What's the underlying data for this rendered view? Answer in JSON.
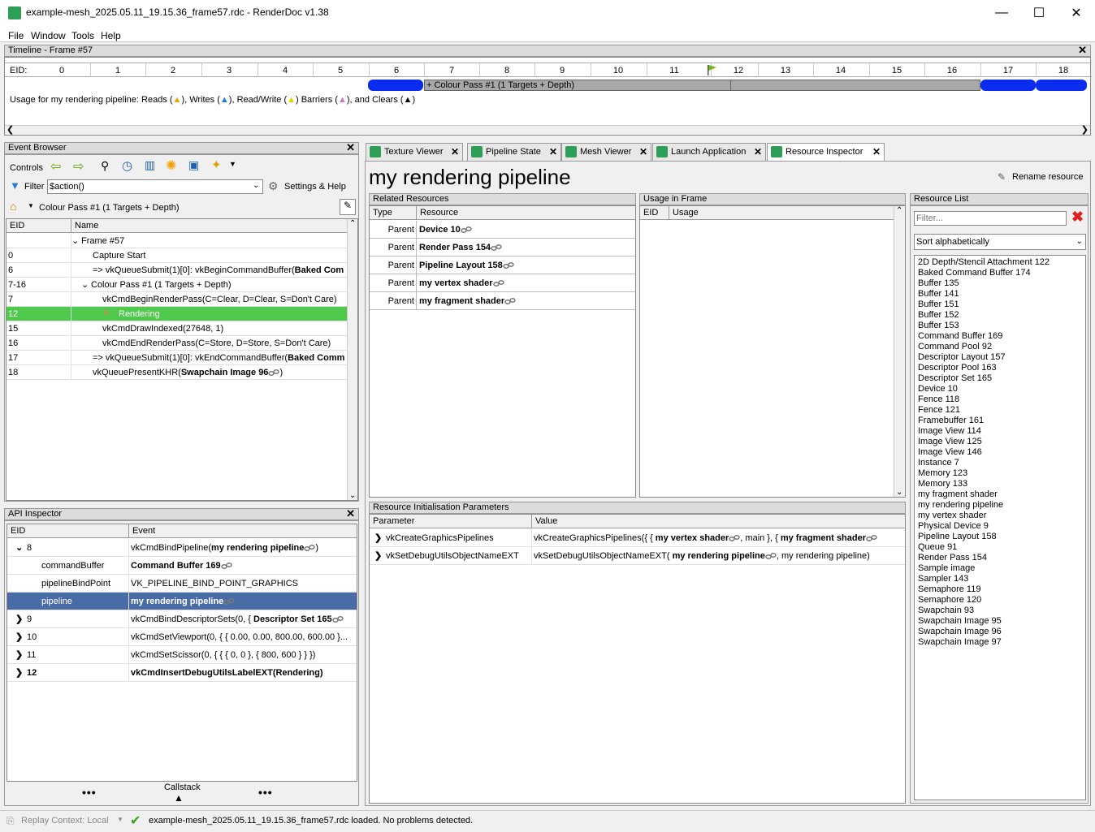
{
  "window": {
    "title": "example-mesh_2025.05.11_19.15.36_frame57.rdc - RenderDoc v1.38",
    "minimize": "—",
    "maximize": "☐",
    "close": "✕"
  },
  "menu": {
    "file": "File",
    "window": "Window",
    "tools": "Tools",
    "help": "Help"
  },
  "timeline": {
    "title": "Timeline - Frame #57",
    "eid_label": "EID:",
    "ticks": [
      "0",
      "1",
      "2",
      "3",
      "4",
      "5",
      "6",
      "7",
      "8",
      "9",
      "10",
      "11",
      "12",
      "13",
      "14",
      "15",
      "16",
      "17",
      "18"
    ],
    "pass_label": "+ Colour Pass #1 (1 Targets + Depth)",
    "usage_prefix": "Usage for my rendering pipeline: Reads (",
    "usage_writes": "), Writes (",
    "usage_rw": "), Read/Write (",
    "usage_barriers": ") Barriers (",
    "usage_clears": "), and Clears (",
    "usage_end": ")"
  },
  "event_browser": {
    "title": "Event Browser",
    "controls_label": "Controls",
    "filter_label": "Filter",
    "filter_value": "$action()",
    "settings_label": "Settings & Help",
    "breadcrumb": "Colour Pass #1 (1 Targets + Depth)",
    "col_eid": "EID",
    "col_name": "Name",
    "rows": [
      {
        "eid": "",
        "name": "Frame #57"
      },
      {
        "eid": "0",
        "name": "Capture Start"
      },
      {
        "eid": "6",
        "name": "=> vkQueueSubmit(1)[0]: vkBeginCommandBuffer(",
        "bold": "Baked Com"
      },
      {
        "eid": "7-16",
        "name": "Colour Pass #1 (1 Targets + Depth)"
      },
      {
        "eid": "7",
        "name": "vkCmdBeginRenderPass(C=Clear, D=Clear, S=Don't Care)"
      },
      {
        "eid": "12",
        "name": "Rendering"
      },
      {
        "eid": "15",
        "name": "vkCmdDrawIndexed(27648, 1)"
      },
      {
        "eid": "16",
        "name": "vkCmdEndRenderPass(C=Store, D=Store, S=Don't Care)"
      },
      {
        "eid": "17",
        "name": "=> vkQueueSubmit(1)[0]: vkEndCommandBuffer(",
        "bold": "Baked Comm"
      },
      {
        "eid": "18",
        "name": "vkQueuePresentKHR(",
        "bold": "Swapchain Image 96",
        "tail": ")"
      }
    ]
  },
  "api_inspector": {
    "title": "API Inspector",
    "col_eid": "EID",
    "col_event": "Event",
    "rows": [
      {
        "eid": "8",
        "event": "vkCmdBindPipeline(",
        "bold": "my rendering pipeline",
        "tail": ")"
      },
      {
        "eid": "commandBuffer",
        "event": "",
        "bold": "Command Buffer 169"
      },
      {
        "eid": "pipelineBindPoint",
        "event": "VK_PIPELINE_BIND_POINT_GRAPHICS"
      },
      {
        "eid": "pipeline",
        "event": "",
        "bold": "my rendering pipeline"
      },
      {
        "eid": "9",
        "event": "vkCmdBindDescriptorSets(0, { ",
        "bold": "Descriptor Set 165"
      },
      {
        "eid": "10",
        "event": "vkCmdSetViewport(0, { { 0.00, 0.00, 800.00, 600.00 }..."
      },
      {
        "eid": "11",
        "event": "vkCmdSetScissor(0, { { { 0, 0 }, { 800, 600 } } })"
      },
      {
        "eid": "12",
        "event": "",
        "bold": "vkCmdInsertDebugUtilsLabelEXT(Rendering)"
      }
    ],
    "callstack": "Callstack"
  },
  "tabs": [
    {
      "label": "Texture Viewer"
    },
    {
      "label": "Pipeline State"
    },
    {
      "label": "Mesh Viewer"
    },
    {
      "label": "Launch Application"
    },
    {
      "label": "Resource Inspector"
    }
  ],
  "resource_inspector": {
    "heading": "my rendering pipeline",
    "rename": "Rename resource",
    "related_title": "Related Resources",
    "col_type": "Type",
    "col_resource": "Resource",
    "related": [
      {
        "type": "Parent",
        "name": "Device 10"
      },
      {
        "type": "Parent",
        "name": "Render Pass 154"
      },
      {
        "type": "Parent",
        "name": "Pipeline Layout 158"
      },
      {
        "type": "Parent",
        "name": "my vertex shader"
      },
      {
        "type": "Parent",
        "name": "my fragment shader"
      }
    ],
    "usage_title": "Usage in Frame",
    "col_ueid": "EID",
    "col_usage": "Usage",
    "init_title": "Resource Initialisation Parameters",
    "col_param": "Parameter",
    "col_value": "Value",
    "init": [
      {
        "param": "vkCreateGraphicsPipelines",
        "value": "vkCreateGraphicsPipelines({ { ",
        "b1": "my vertex shader",
        "mid": ", main }, { ",
        "b2": "my fragment shader"
      },
      {
        "param": "vkSetDebugUtilsObjectNameEXT",
        "value": "vkSetDebugUtilsObjectNameEXT( ",
        "b1": "my rendering pipeline",
        "mid": ", my rendering pipeline)",
        "b2": ""
      }
    ],
    "list_title": "Resource List",
    "filter_placeholder": "Filter...",
    "sort": "Sort alphabetically",
    "resources": [
      "2D Depth/Stencil Attachment 122",
      "Baked Command Buffer 174",
      "Buffer 135",
      "Buffer 141",
      "Buffer 151",
      "Buffer 152",
      "Buffer 153",
      "Command Buffer 169",
      "Command Pool 92",
      "Descriptor Layout 157",
      "Descriptor Pool 163",
      "Descriptor Set 165",
      "Device 10",
      "Fence 118",
      "Fence 121",
      "Framebuffer 161",
      "Image View 114",
      "Image View 125",
      "Image View 146",
      "Instance 7",
      "Memory 123",
      "Memory 133",
      "my fragment shader",
      "my rendering pipeline",
      "my vertex shader",
      "Physical Device 9",
      "Pipeline Layout 158",
      "Queue 91",
      "Render Pass 154",
      "Sample image",
      "Sampler 143",
      "Semaphore 119",
      "Semaphore 120",
      "Swapchain 93",
      "Swapchain Image 95",
      "Swapchain Image 96",
      "Swapchain Image 97"
    ]
  },
  "status": {
    "context": "Replay Context: Local",
    "message": "example-mesh_2025.05.11_19.15.36_frame57.rdc loaded. No problems detected."
  },
  "colors": {
    "accent_green": "#4ec94b",
    "selection_blue": "#4a6ca6",
    "timeline_blue": "#0a2cf0",
    "pass_grey": "#a8a8a8"
  }
}
